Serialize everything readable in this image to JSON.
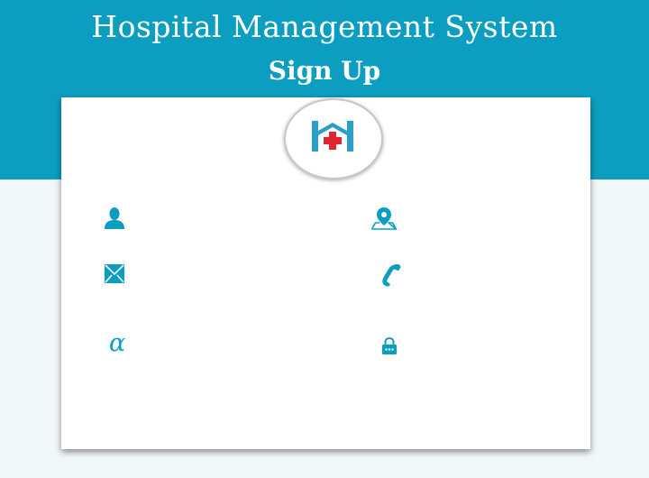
{
  "header": {
    "app_title": "Hospital Management System",
    "page_heading": "Sign Up"
  },
  "form": {
    "logo_icon": "hospital-logo-icon",
    "fields": [
      {
        "icon": "user-icon",
        "value": "",
        "placeholder": ""
      },
      {
        "icon": "map-pin-icon",
        "value": "",
        "placeholder": ""
      },
      {
        "icon": "envelope-icon",
        "value": "",
        "placeholder": ""
      },
      {
        "icon": "phone-icon",
        "value": "",
        "placeholder": ""
      },
      {
        "icon": "alpha-icon",
        "value": "",
        "placeholder": ""
      },
      {
        "icon": "lock-icon",
        "value": "",
        "placeholder": ""
      }
    ]
  },
  "colors": {
    "accent": "#0c9ec1",
    "logo_cross": "#e0262e",
    "background": "#f1f8fa",
    "card": "#ffffff"
  }
}
